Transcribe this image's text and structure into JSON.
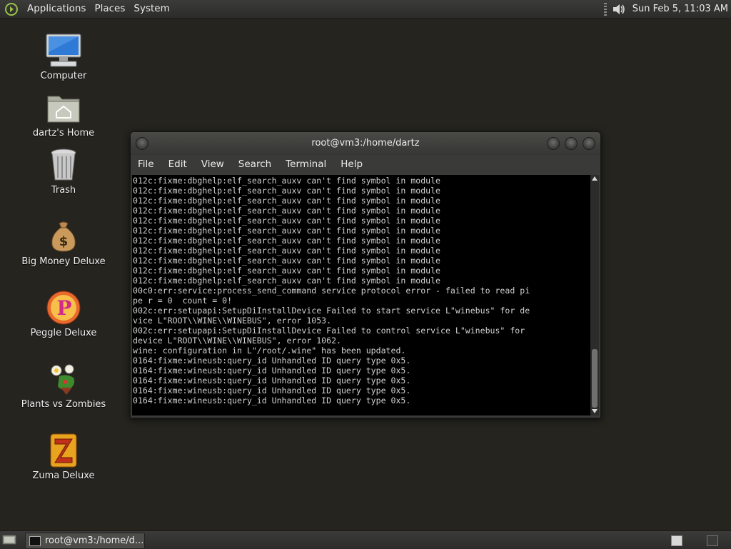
{
  "top_panel": {
    "menus": [
      "Applications",
      "Places",
      "System"
    ],
    "clock": "Sun Feb  5, 11:03 AM"
  },
  "desktop": {
    "icons": [
      {
        "label": "Computer",
        "icon": "computer-icon"
      },
      {
        "label": "dartz's Home",
        "icon": "home-folder-icon"
      },
      {
        "label": "Trash",
        "icon": "trash-icon"
      },
      {
        "label": "Big Money Deluxe",
        "icon": "money-bag-icon"
      },
      {
        "label": "Peggle Deluxe",
        "icon": "peggle-icon"
      },
      {
        "label": "Plants vs Zombies",
        "icon": "plants-vs-zombies-icon"
      },
      {
        "label": "Zuma Deluxe",
        "icon": "zuma-icon"
      }
    ]
  },
  "terminal": {
    "title": "root@vm3:/home/dartz",
    "menus": [
      "File",
      "Edit",
      "View",
      "Search",
      "Terminal",
      "Help"
    ],
    "lines": [
      "012c:fixme:dbghelp:elf_search_auxv can't find symbol in module",
      "012c:fixme:dbghelp:elf_search_auxv can't find symbol in module",
      "012c:fixme:dbghelp:elf_search_auxv can't find symbol in module",
      "012c:fixme:dbghelp:elf_search_auxv can't find symbol in module",
      "012c:fixme:dbghelp:elf_search_auxv can't find symbol in module",
      "012c:fixme:dbghelp:elf_search_auxv can't find symbol in module",
      "012c:fixme:dbghelp:elf_search_auxv can't find symbol in module",
      "012c:fixme:dbghelp:elf_search_auxv can't find symbol in module",
      "012c:fixme:dbghelp:elf_search_auxv can't find symbol in module",
      "012c:fixme:dbghelp:elf_search_auxv can't find symbol in module",
      "012c:fixme:dbghelp:elf_search_auxv can't find symbol in module",
      "00c0:err:service:process_send_command service protocol error - failed to read pi",
      "pe r = 0  count = 0!",
      "002c:err:setupapi:SetupDiInstallDevice Failed to start service L\"winebus\" for de",
      "vice L\"ROOT\\\\WINE\\\\WINEBUS\", error 1053.",
      "002c:err:setupapi:SetupDiInstallDevice Failed to control service L\"winebus\" for",
      "device L\"ROOT\\\\WINE\\\\WINEBUS\", error 1062.",
      "wine: configuration in L\"/root/.wine\" has been updated.",
      "0164:fixme:wineusb:query_id Unhandled ID query type 0x5.",
      "0164:fixme:wineusb:query_id Unhandled ID query type 0x5.",
      "0164:fixme:wineusb:query_id Unhandled ID query type 0x5.",
      "0164:fixme:wineusb:query_id Unhandled ID query type 0x5.",
      "0164:fixme:wineusb:query_id Unhandled ID query type 0x5."
    ]
  },
  "bottom_panel": {
    "task_label": "root@vm3:/home/d..."
  }
}
